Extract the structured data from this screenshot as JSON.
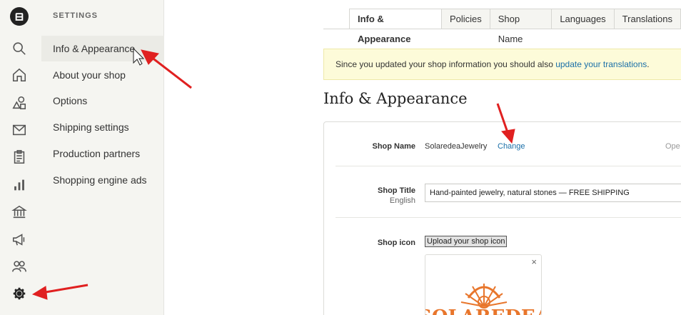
{
  "rail": {
    "icons": [
      "etsy-logo-icon",
      "search-icon",
      "home-icon",
      "listings-icon",
      "messages-icon",
      "orders-icon",
      "stats-icon",
      "finances-icon",
      "marketing-icon",
      "community-icon",
      "settings-icon"
    ]
  },
  "nav": {
    "heading": "SETTINGS",
    "items": [
      {
        "label": "Info & Appearance",
        "active": true
      },
      {
        "label": "About your shop"
      },
      {
        "label": "Options"
      },
      {
        "label": "Shipping settings"
      },
      {
        "label": "Production partners"
      },
      {
        "label": "Shopping engine ads"
      }
    ]
  },
  "tabs": [
    {
      "label": "Info & Appearance",
      "active": true
    },
    {
      "label": "Policies"
    },
    {
      "label": "Shop Name"
    },
    {
      "label": "Languages"
    },
    {
      "label": "Translations"
    }
  ],
  "notice": {
    "text": "Since you updated your shop information you should also ",
    "link": "update your translations",
    "suffix": "."
  },
  "page_title": "Info & Appearance",
  "form": {
    "shop_name_label": "Shop Name",
    "shop_name_value": "SolaredeaJewelry",
    "shop_name_change": "Change",
    "shop_name_truncated": "Ope",
    "shop_title_label": "Shop Title",
    "shop_title_sublabel": "English",
    "shop_title_value": "Hand-painted jewelry, natural stones — FREE SHIPPING",
    "shop_icon_label": "Shop icon",
    "upload_button": "Upload your shop icon",
    "remove_icon": "×",
    "logo_text": "SOLAREDEA"
  },
  "colors": {
    "link": "#1a6fa8",
    "annotation": "#e02020",
    "notice_bg": "#fdfbd9",
    "logo": "#e8762c"
  }
}
